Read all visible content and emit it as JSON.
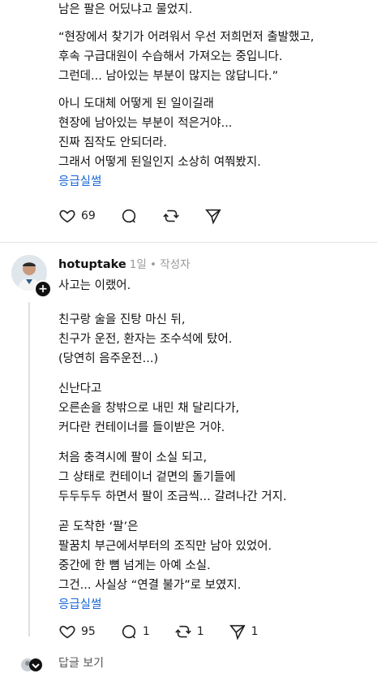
{
  "top_post": {
    "lines_a": [
      "남은 팔은 어딨냐고 물었지."
    ],
    "lines_b": [
      "“현장에서 찾기가 어려워서 우선 저희먼저 출발했고,",
      "후속 구급대원이 수습해서 가져오는 중입니다.",
      "그런데... 남아있는 부분이 많지는 않답니다.”"
    ],
    "lines_c": [
      "아니 도대체 어떻게 된 일이길래",
      "현장에 남아있는 부분이 적은거야...",
      "진짜 짐작도 안되더라.",
      "그래서 어떻게 된일인지 소상히 여쭤봤지."
    ],
    "link": "응급실썰",
    "likes": "69"
  },
  "reply": {
    "username": "hotuptake",
    "meta": "1일 • 작성자",
    "first_line": "사고는 이랬어.",
    "p1": [
      "친구랑 술을 진탕 마신 뒤,",
      "친구가 운전, 환자는 조수석에 탔어.",
      "(당연히 음주운전...)"
    ],
    "p2": [
      "신난다고",
      "오른손을 창밖으로 내민 채 달리다가,",
      "커다란 컨테이너를 들이받은 거야."
    ],
    "p3": [
      "처음 충격시에 팔이 소실 되고,",
      "그 상태로 컨테이너 겉면의 돌기들에",
      "두두두두 하면서 팔이 조금씩... 갈려나간 거지."
    ],
    "p4": [
      "곧 도착한 ‘팔’은",
      "팔꿈치 부근에서부터의 조직만 남아 있었어.",
      "중간에 한 뼘 넘게는 아예 소실.",
      "그건... 사실상 “연결 불가”로 보였지."
    ],
    "link": "응급실썰",
    "likes": "95",
    "comments": "1",
    "reposts": "1",
    "shares": "1"
  },
  "view_replies": "답글 보기"
}
